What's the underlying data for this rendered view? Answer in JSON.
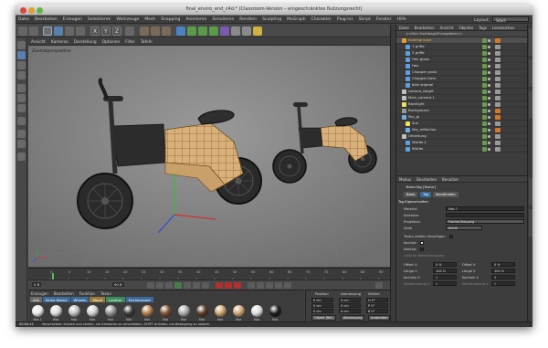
{
  "window": {
    "title": "final_enviro_end_c4d.* (Classroom-Version – eingeschränktes Nutzungsrecht)"
  },
  "menubar": {
    "items": [
      "Datei",
      "Bearbeiten",
      "Erzeugen",
      "Selektieren",
      "Werkzeuge",
      "Mesh",
      "Snapping",
      "Animieren",
      "Simulieren",
      "Rendern",
      "Sculpting",
      "MoGraph",
      "Charakter",
      "Plug-ins",
      "Skript",
      "Fenster",
      "Hilfe"
    ],
    "layout_label": "Layout:",
    "layout_value": "Start"
  },
  "toolbar": {
    "axis_labels": [
      "X",
      "Y",
      "Z"
    ]
  },
  "viewport": {
    "menu": [
      "Ansicht",
      "Kameras",
      "Darstellung",
      "Optionen",
      "Filter",
      "Tafeln"
    ],
    "view_label": "Zentralperspektive"
  },
  "timeline": {
    "ticks": [
      "0",
      "5",
      "10",
      "15",
      "20",
      "25",
      "30",
      "35",
      "40",
      "45",
      "50",
      "55",
      "60",
      "65",
      "70",
      "75",
      "80",
      "85",
      "90"
    ],
    "start": "0 B",
    "end": "90 B",
    "current": "0 B"
  },
  "material_panel": {
    "menu": [
      "Erzeugen",
      "Bearbeiten",
      "Funktion",
      "Textur"
    ],
    "tabs": [
      "Alle",
      "Keine Ebene",
      "Wheels",
      "Wood",
      "Leather",
      "Environment"
    ],
    "materials": [
      {
        "label": "Mat.1",
        "color": "#e8e8e8"
      },
      {
        "label": "Mat",
        "color": "#d9d9d9"
      },
      {
        "label": "Mat",
        "color": "#bfbfbf"
      },
      {
        "label": "Mat",
        "color": "#cfcfcf"
      },
      {
        "label": "Mat",
        "color": "#909090"
      },
      {
        "label": "Mat",
        "color": "#3a3a3a"
      },
      {
        "label": "Mat",
        "color": "#b07a4a"
      },
      {
        "label": "Mat",
        "color": "#7a5034"
      },
      {
        "label": "Mat",
        "color": "#a8a8a8"
      },
      {
        "label": "Mat",
        "color": "#5a3a26"
      },
      {
        "label": "Mat",
        "color": "#c9a06a"
      },
      {
        "label": "Mat",
        "color": "#caa070"
      },
      {
        "label": "Mat",
        "color": "#dcdcdc"
      },
      {
        "label": "Mat",
        "color": "#1c1c1c"
      }
    ]
  },
  "coord_panel": {
    "headers": [
      "Position",
      "Abmessung",
      "Winkel"
    ],
    "rows": [
      {
        "axis": "X",
        "pos": "0 cm",
        "size": "0 cm",
        "angle": "H 0°"
      },
      {
        "axis": "Y",
        "pos": "0 cm",
        "size": "0 cm",
        "angle": "P 0°"
      },
      {
        "axis": "Z",
        "pos": "0 cm",
        "size": "0 cm",
        "angle": "B 0°"
      }
    ],
    "mode1": "Objekt (Rel)",
    "mode2": "Abmessung",
    "apply": "Anwenden"
  },
  "object_panel": {
    "menu": [
      "Datei",
      "Bearbeiten",
      "Ansicht",
      "Objekte",
      "Tags",
      "Lesezeichen"
    ],
    "toolbar_label": "<<Hier Suchbegriff eingeben>>",
    "objects": [
      {
        "name": "bodengruppe",
        "icon": "#e0a030",
        "tag": "#d07a2a",
        "indent": 4,
        "highlight": true
      },
      {
        "name": "1 griffe",
        "icon": "#60a0e0",
        "tag": "#9a9a9a",
        "indent": 8,
        "highlight": false
      },
      {
        "name": "2 griffe",
        "icon": "#60a0e0",
        "tag": "#9a9a9a",
        "indent": 8,
        "highlight": false
      },
      {
        "name": "Hex gross",
        "icon": "#60a0e0",
        "tag": "#9a9a9a",
        "indent": 8,
        "highlight": false
      },
      {
        "name": "Hex",
        "icon": "#60a0e0",
        "tag": "#9a9a9a",
        "indent": 8,
        "highlight": false
      },
      {
        "name": "Chopper gross",
        "icon": "#60a0e0",
        "tag": "#9a9a9a",
        "indent": 8,
        "highlight": false
      },
      {
        "name": "Chopper klein",
        "icon": "#60a0e0",
        "tag": "#9a9a9a",
        "indent": 8,
        "highlight": false
      },
      {
        "name": "bike original",
        "icon": "#60a0e0",
        "tag": "#9a9a9a",
        "indent": 8,
        "highlight": false
      },
      {
        "name": "camera_target",
        "icon": "#c0c0c0",
        "tag": "#9a9a9a",
        "indent": 4,
        "highlight": false
      },
      {
        "name": "Main_camera.1",
        "icon": "#c0c0c0",
        "tag": "#9a9a9a",
        "indent": 4,
        "highlight": false
      },
      {
        "name": "Backlight",
        "icon": "#f0e060",
        "tag": "#9a9a9a",
        "indent": 4,
        "highlight": false
      },
      {
        "name": "Background",
        "icon": "#9a9a9a",
        "tag": "#d07a2a",
        "indent": 4,
        "highlight": false
      },
      {
        "name": "Sky_gi",
        "icon": "#70b0e0",
        "tag": "#d07a2a",
        "indent": 4,
        "highlight": false
      },
      {
        "name": "Sun",
        "icon": "#f0e060",
        "tag": "#9a9a9a",
        "indent": 8,
        "highlight": false
      },
      {
        "name": "Sky_reflection",
        "icon": "#70b0e0",
        "tag": "#d07a2a",
        "indent": 8,
        "highlight": false
      },
      {
        "name": "Umleitung",
        "icon": "#c0c0c0",
        "tag": "#9a9a9a",
        "indent": 4,
        "highlight": false
      },
      {
        "name": "Würfel.1",
        "icon": "#60a0e0",
        "tag": "#9a9a9a",
        "indent": 8,
        "highlight": false
      },
      {
        "name": "Würfel",
        "icon": "#60a0e0",
        "tag": "#9a9a9a",
        "indent": 8,
        "highlight": false
      }
    ]
  },
  "attr_panel": {
    "menu": [
      "Modus",
      "Bearbeiten",
      "Benutzer"
    ],
    "title": "Textur-Tag [Textur]",
    "tabs": [
      "Basis",
      "Tag",
      "Koordinaten"
    ],
    "section": "Tag-Eigenschaften",
    "props": [
      {
        "label": "Material",
        "value": "Mat.7"
      },
      {
        "label": "Selektion",
        "value": ""
      },
      {
        "label": "Projektion",
        "value": "Frontal-Mapping"
      },
      {
        "label": "Seite",
        "value": "Beide"
      }
    ],
    "checks": [
      "Textur additiv hinzufügen",
      "Kacheln",
      "Nahtlos",
      "UVW für Relief benutzen"
    ],
    "offset_u": {
      "label": "Offset U",
      "value": "0 %"
    },
    "offset_v": {
      "label": "Offset V",
      "value": "0 %"
    },
    "laenge_u": {
      "label": "Länge U",
      "value": "100 %"
    },
    "laenge_v": {
      "label": "Länge V",
      "value": "100 %"
    },
    "kacheln_u": {
      "label": "Kacheln U",
      "value": "1"
    },
    "kacheln_v": {
      "label": "Kacheln V",
      "value": "1"
    },
    "wdh_u": {
      "label": "Wiederholung U",
      "value": "0"
    },
    "wdh_v": {
      "label": "Wiederholung V",
      "value": "0"
    }
  },
  "statusbar": {
    "time": "00:00:12",
    "text": "Verschieben: Klicken und ziehen, um Elemente zu verschieben. SHIFT drücken, um Bewegung zu rastern."
  }
}
